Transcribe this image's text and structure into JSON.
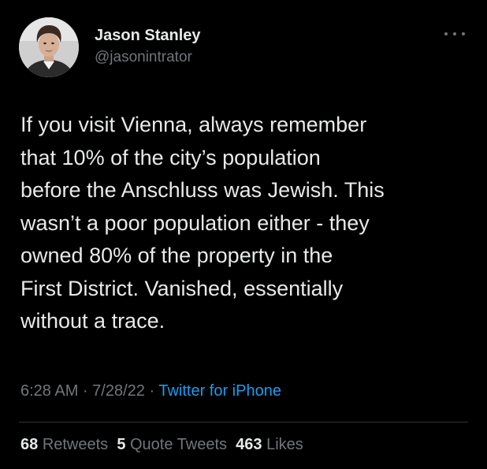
{
  "author": {
    "display_name": "Jason Stanley",
    "handle": "@jasonintrator",
    "avatar_icon": "person-portrait"
  },
  "more_icon": "more-horizontal-icon",
  "tweet": {
    "text": "If you visit Vienna, always remember\nthat 10% of the city’s population\nbefore the Anschluss was Jewish. This\nwasn’t a poor population either - they\nowned 80% of the property in the\nFirst District. Vanished, essentially\nwithout a trace.",
    "time": "6:28 AM",
    "separator": " · ",
    "date": "7/28/22",
    "source": "Twitter for iPhone"
  },
  "stats": {
    "retweets_count": "68",
    "retweets_label": "Retweets",
    "quotes_count": "5",
    "quotes_label": "Quote Tweets",
    "likes_count": "463",
    "likes_label": "Likes"
  },
  "colors": {
    "background": "#000000",
    "primary_text": "#e7e9ea",
    "secondary_text": "#71767b",
    "link": "#1d9bf0",
    "divider": "#2f3336"
  }
}
